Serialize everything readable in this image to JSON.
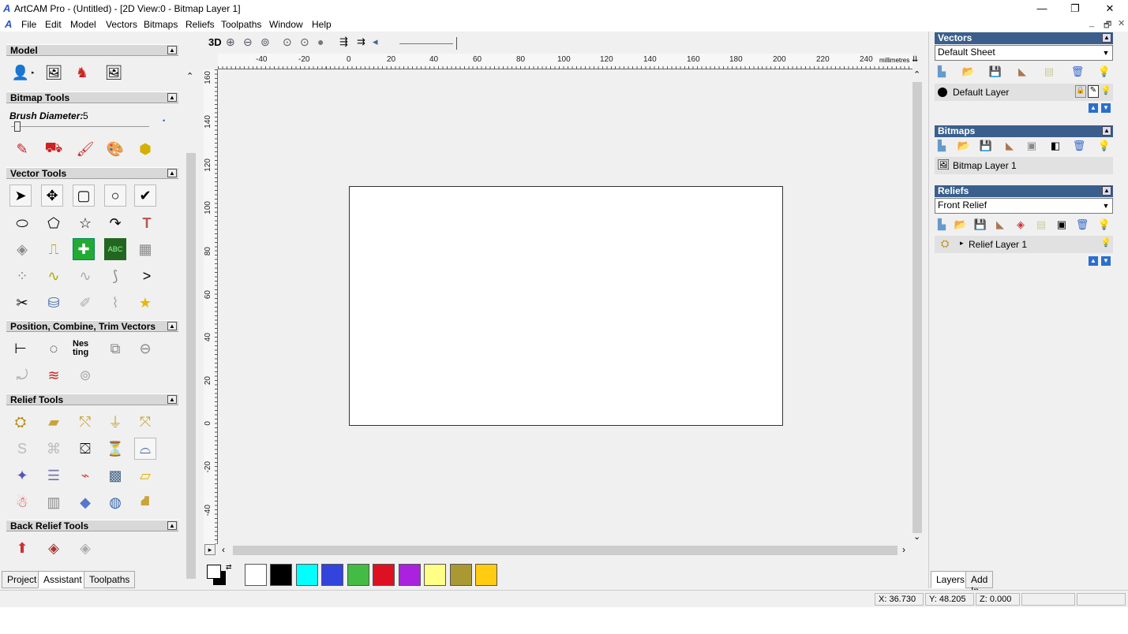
{
  "window": {
    "title": "ArtCAM Pro - (Untitled) - [2D View:0 - Bitmap Layer 1]",
    "minimize": "—",
    "maximize": "❐",
    "close": "✕"
  },
  "menu": {
    "items": [
      "File",
      "Edit",
      "Model",
      "Vectors",
      "Bitmaps",
      "Reliefs",
      "Toolpaths",
      "Window",
      "Help"
    ],
    "doc_min": "_",
    "doc_restore": "🗗",
    "doc_close": "✕"
  },
  "left": {
    "sections": {
      "model": "Model",
      "bitmap_tools": "Bitmap Tools",
      "vector_tools": "Vector Tools",
      "position": "Position, Combine, Trim Vectors",
      "relief_tools": "Relief Tools",
      "back_relief": "Back Relief Tools"
    },
    "brush_label": "Brush Diameter:",
    "brush_value": "5",
    "nesting_label": "Nes ting",
    "tabs": [
      "Project",
      "Assistant",
      "Toolpaths"
    ],
    "active_tab": "Assistant"
  },
  "view_toolbar": {
    "label_3d": "3D"
  },
  "ruler": {
    "unit": "millimetres",
    "top_ticks": [
      "-40",
      "-20",
      "0",
      "20",
      "40",
      "60",
      "80",
      "100",
      "120",
      "140",
      "160",
      "180",
      "200",
      "220",
      "240"
    ],
    "left_ticks": [
      "160",
      "140",
      "120",
      "100",
      "80",
      "60",
      "40",
      "20",
      "0",
      "-20",
      "-40"
    ]
  },
  "palette": {
    "colors": [
      "#ffffff",
      "#000000",
      "#00ffff",
      "#3344dd",
      "#44bb44",
      "#dd1122",
      "#aa22dd",
      "#ffff88",
      "#aa9933",
      "#ffcc11"
    ]
  },
  "right": {
    "vectors_header": "Vectors",
    "vectors_sheet": "Default Sheet",
    "vectors_layer": "Default Layer",
    "bitmaps_header": "Bitmaps",
    "bitmap_layer": "Bitmap Layer 1",
    "reliefs_header": "Reliefs",
    "reliefs_select": "Front Relief",
    "relief_layer": "Relief Layer 1",
    "tabs": [
      "Layers",
      "Add In"
    ],
    "active_tab": "Layers"
  },
  "status": {
    "x": "X: 36.730",
    "y": "Y: 48.205",
    "z": "Z: 0.000"
  }
}
